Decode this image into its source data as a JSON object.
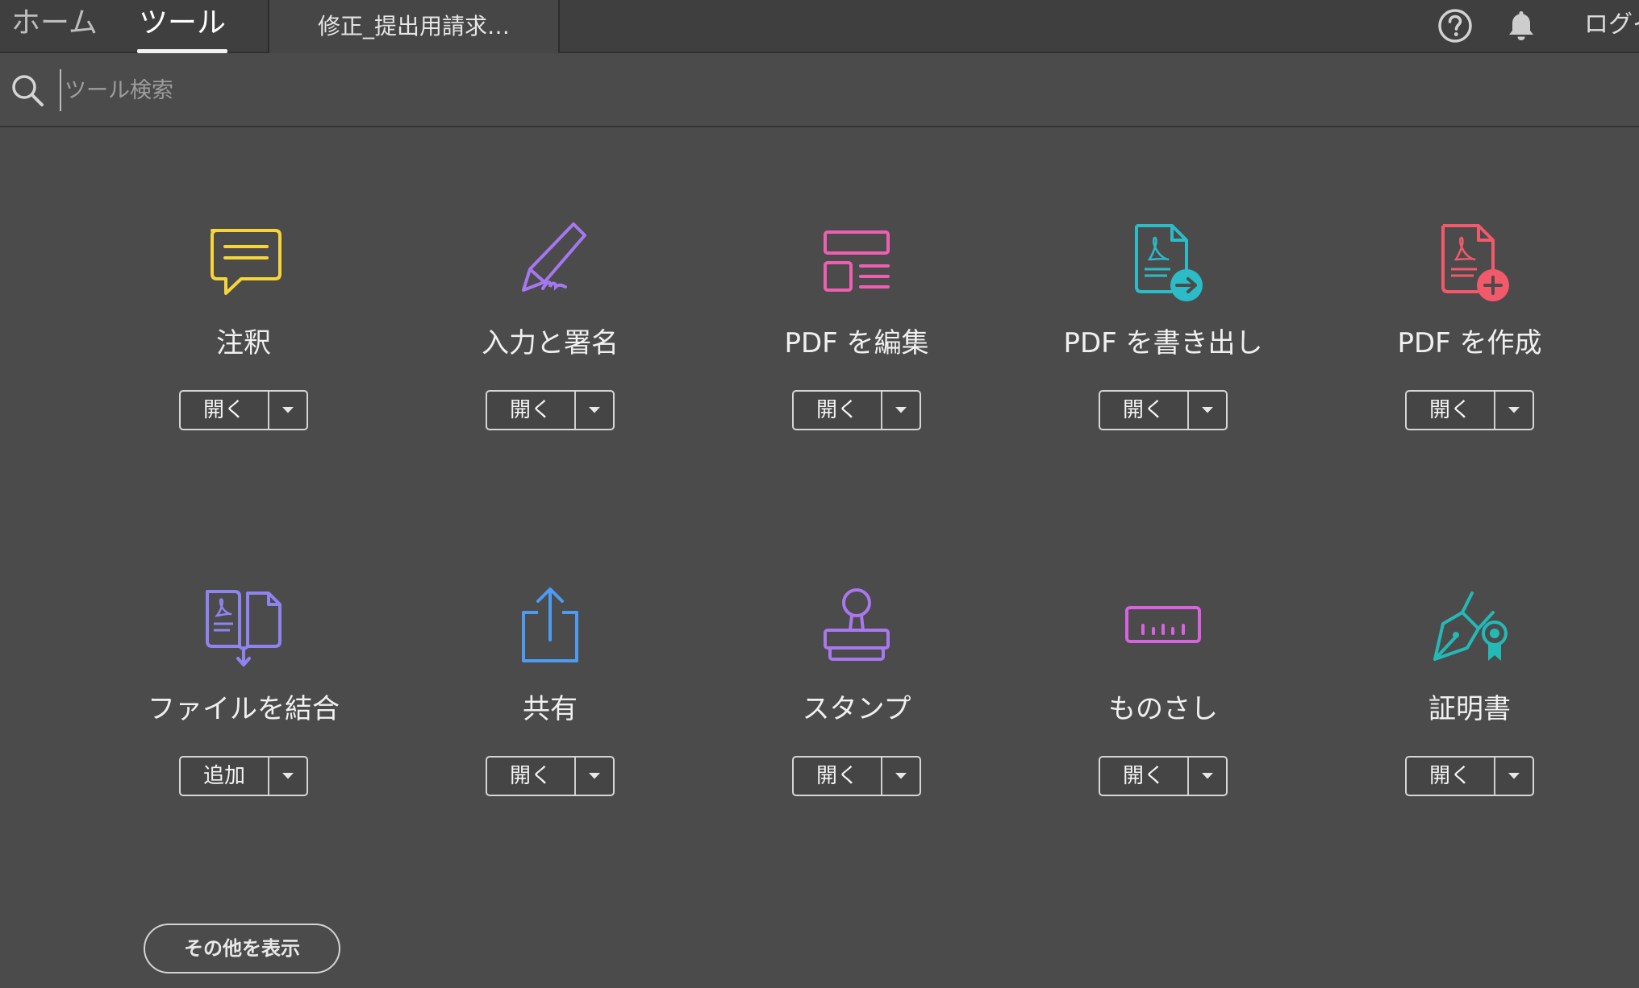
{
  "header": {
    "tabs": [
      {
        "label": "ホーム",
        "selected": false
      },
      {
        "label": "ツール",
        "selected": true
      }
    ],
    "document_tab": "修正_提出用請求…",
    "login_label": "ログイ"
  },
  "search": {
    "placeholder": "ツール検索",
    "value": ""
  },
  "tools": [
    {
      "label": "注釈",
      "button": "開く",
      "icon": "comment-icon",
      "color": "#f7d53a"
    },
    {
      "label": "入力と署名",
      "button": "開く",
      "icon": "fill-sign-icon",
      "color": "#a577f0"
    },
    {
      "label": "PDF を編集",
      "button": "開く",
      "icon": "edit-pdf-icon",
      "color": "#ee5fb2"
    },
    {
      "label": "PDF を書き出し",
      "button": "開く",
      "icon": "export-pdf-icon",
      "color": "#2bbcc7"
    },
    {
      "label": "PDF を作成",
      "button": "開く",
      "icon": "create-pdf-icon",
      "color": "#f2596b"
    },
    {
      "label": "ファイルを結合",
      "button": "追加",
      "icon": "combine-files-icon",
      "color": "#8f84ef"
    },
    {
      "label": "共有",
      "button": "開く",
      "icon": "share-icon",
      "color": "#4d9cf2"
    },
    {
      "label": "スタンプ",
      "button": "開く",
      "icon": "stamp-icon",
      "color": "#a977ee"
    },
    {
      "label": "ものさし",
      "button": "開く",
      "icon": "measure-icon",
      "color": "#d862e0"
    },
    {
      "label": "証明書",
      "button": "開く",
      "icon": "certificate-icon",
      "color": "#24b9b6"
    }
  ],
  "more_button": "その他を表示"
}
